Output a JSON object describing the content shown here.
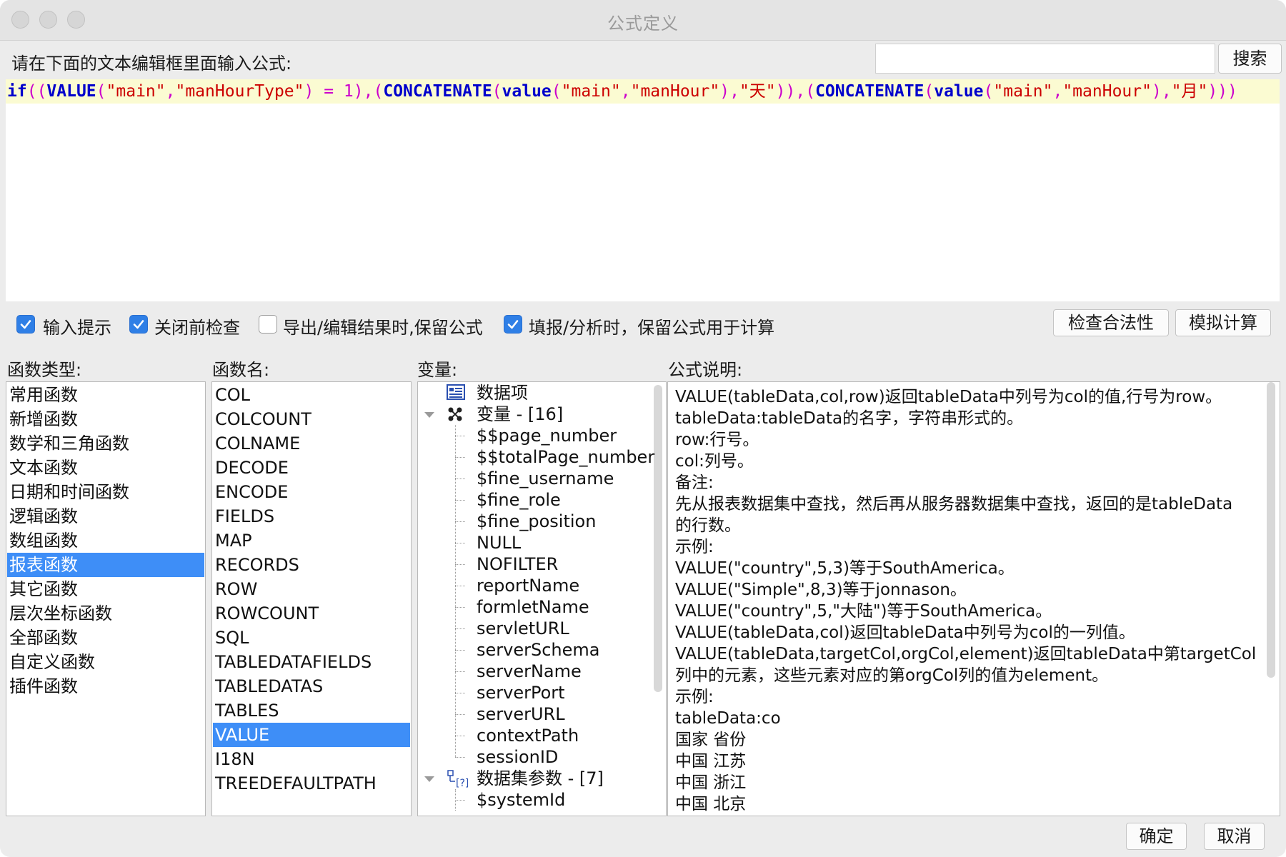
{
  "window": {
    "title": "公式定义"
  },
  "prompt": {
    "label": "请在下面的文本编辑框里面输入公式:"
  },
  "search": {
    "value": "",
    "button_label": "搜索"
  },
  "formula": {
    "text": "if((VALUE(\"main\",\"manHourType\") = 1),(CONCATENATE(value(\"main\",\"manHour\"),\"天\")),(CONCATENATE(value(\"main\",\"manHour\"),\"月\")))"
  },
  "options": [
    {
      "label": "输入提示",
      "checked": true
    },
    {
      "label": "关闭前检查",
      "checked": true
    },
    {
      "label": "导出/编辑结果时,保留公式",
      "checked": false
    },
    {
      "label": "填报/分析时，保留公式用于计算",
      "checked": true
    }
  ],
  "actions": {
    "check_label": "检查合法性",
    "simulate_label": "模拟计算"
  },
  "headers": {
    "function_types": "函数类型:",
    "function_names": "函数名:",
    "variables": "变量:",
    "description": "公式说明:"
  },
  "function_types": [
    "常用函数",
    "新增函数",
    "数学和三角函数",
    "文本函数",
    "日期和时间函数",
    "逻辑函数",
    "数组函数",
    "报表函数",
    "其它函数",
    "层次坐标函数",
    "全部函数",
    "自定义函数",
    "插件函数"
  ],
  "selected_function_type": "报表函数",
  "function_names": [
    "COL",
    "COLCOUNT",
    "COLNAME",
    "DECODE",
    "ENCODE",
    "FIELDS",
    "MAP",
    "RECORDS",
    "ROW",
    "ROWCOUNT",
    "SQL",
    "TABLEDATAFIELDS",
    "TABLEDATAS",
    "TABLES",
    "VALUE",
    "I18N",
    "TREEDEFAULTPATH"
  ],
  "selected_function_name": "VALUE",
  "variables": {
    "data_items_label": "数据项",
    "variables_group_label": "变量 - [16]",
    "variables_items": [
      "$$page_number",
      "$$totalPage_number",
      "$fine_username",
      "$fine_role",
      "$fine_position",
      "NULL",
      "NOFILTER",
      "reportName",
      "formletName",
      "servletURL",
      "serverSchema",
      "serverName",
      "serverPort",
      "serverURL",
      "contextPath",
      "sessionID"
    ],
    "dataset_params_label": "数据集参数 - [7]",
    "dataset_params_items": [
      "$systemId"
    ]
  },
  "description_lines": [
    "VALUE(tableData,col,row)返回tableData中列号为col的值,行号为row。",
    "tableData:tableData的名字，字符串形式的。",
    "row:行号。",
    "col:列号。",
    "备注:",
    "先从报表数据集中查找，然后再从服务器数据集中查找，返回的是tableData",
    "的行数。",
    "示例:",
    "VALUE(\"country\",5,3)等于SouthAmerica。",
    "VALUE(\"Simple\",8,3)等于jonnason。",
    "VALUE(\"country\",5,\"大陆\")等于SouthAmerica。",
    "VALUE(tableData,col)返回tableData中列号为col的一列值。",
    "VALUE(tableData,targetCol,orgCol,element)返回tableData中第targetCol",
    "列中的元素，这些元素对应的第orgCol列的值为element。",
    "示例:",
    "tableData:co",
    "国家 省份",
    "中国 江苏",
    "中国 浙江",
    "中国 北京"
  ],
  "footer": {
    "ok_label": "确定",
    "cancel_label": "取消"
  }
}
